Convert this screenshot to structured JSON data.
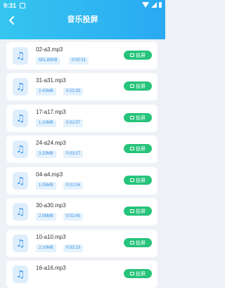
{
  "status": {
    "time": "9:31"
  },
  "header": {
    "title": "音乐投屏"
  },
  "cast_label": "投屏",
  "files": [
    {
      "name": "02-a3.mp3",
      "size": "551.89KB",
      "duration": "0:00:31"
    },
    {
      "name": "31-a31.mp3",
      "size": "2.41MB",
      "duration": "0:02:33"
    },
    {
      "name": "17-a17.mp3",
      "size": "1.10MB",
      "duration": "0:01:07"
    },
    {
      "name": "24-a24.mp3",
      "size": "3.23MB",
      "duration": "0:03:27"
    },
    {
      "name": "04-a4.mp3",
      "size": "1.05MB",
      "duration": "0:01:04"
    },
    {
      "name": "30-a30.mp3",
      "size": "2.59MB",
      "duration": "0:02:45"
    },
    {
      "name": "10-a10.mp3",
      "size": "2.10MB",
      "duration": "0:02:13"
    },
    {
      "name": "16-a16.mp3",
      "size": "",
      "duration": ""
    }
  ]
}
